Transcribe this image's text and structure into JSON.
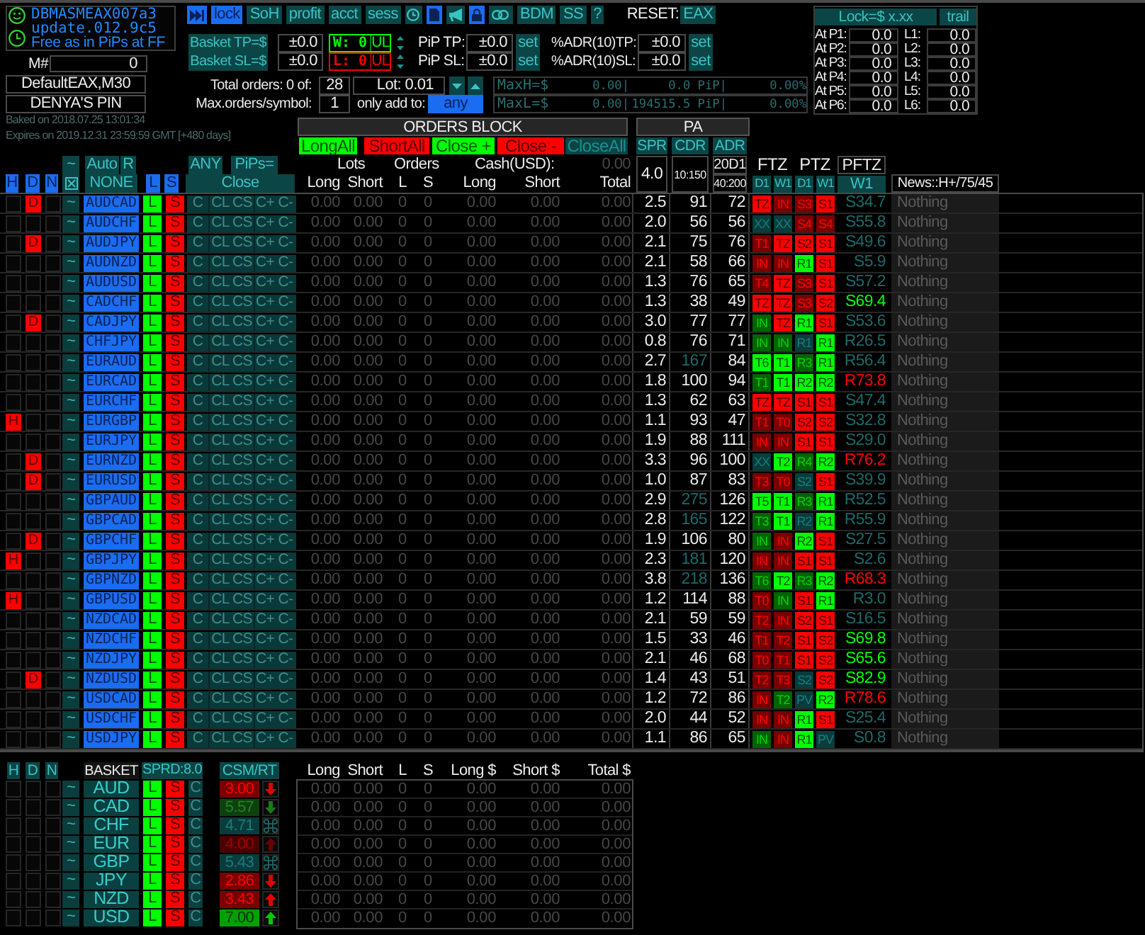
{
  "info": {
    "lines": [
      "DBMASMEAX007a3",
      "update.012.9c5",
      "Free as in PiPs at FF"
    ]
  },
  "magic": {
    "label": "M#",
    "value": "0"
  },
  "profile": [
    "DefaultEAX,M30",
    "DENYA'S PIN"
  ],
  "license": [
    "Baked on 2018.07.25 13:01:34",
    "Expires on 2019.12.31 23:59:59 GMT [+480 days]"
  ],
  "toolbar": [
    {
      "kind": "icon",
      "on": true
    },
    {
      "kind": "text",
      "label": "lock",
      "on": true
    },
    {
      "kind": "text",
      "label": "SoH",
      "on": false
    },
    {
      "kind": "text",
      "label": "profit",
      "on": false
    },
    {
      "kind": "text",
      "label": "acct",
      "on": false
    },
    {
      "kind": "text",
      "label": "sess",
      "on": false
    },
    {
      "kind": "icon",
      "on": false
    },
    {
      "kind": "icon",
      "on": true
    },
    {
      "kind": "icon",
      "on": false
    },
    {
      "kind": "icon",
      "on": true
    },
    {
      "kind": "icon",
      "on": false
    },
    {
      "kind": "text",
      "label": "BDM",
      "on": false
    },
    {
      "kind": "text",
      "label": "SS",
      "on": false
    },
    {
      "kind": "text",
      "label": "?",
      "on": false
    }
  ],
  "reset": {
    "label": "RESET:",
    "value": "EAX"
  },
  "targets": [
    {
      "button": "Basket TP=$",
      "value": "±0.0",
      "counter": "W: 0",
      "unit": "UL",
      "color": "#00ff00",
      "pip_label": "PiP TP:",
      "pip_value": "±0.0",
      "pip_set": "set",
      "adr_label": "%ADR(10)TP:",
      "adr_value": "±0.0",
      "adr_set": "set"
    },
    {
      "button": "Basket SL=$",
      "value": "±0.0",
      "counter": "L: 0",
      "unit": "UL",
      "color": "#ff0000",
      "pip_label": "PiP SL:",
      "pip_value": "±0.0",
      "pip_set": "set",
      "adr_label": "%ADR(10)SL:",
      "adr_value": "±0.0",
      "adr_set": "set"
    }
  ],
  "limits": {
    "total_label": "Total orders: 0 of:",
    "total_value": "28",
    "lot": "Lot: 0.01",
    "max_label": "Max.orders/symbol:",
    "max_value": "1",
    "add_label": "only add to:",
    "add_value": "any"
  },
  "max_rows": [
    {
      "label": "MaxH=$",
      "cells": [
        "0.00|",
        "0.0 PiP|",
        "0.00%"
      ]
    },
    {
      "label": "MaxL=$",
      "cells": [
        "0.00|",
        "194515.5 PiP|",
        "0.00%"
      ]
    }
  ],
  "lock": {
    "title": "Lock=$ x.xx",
    "trail": "trail",
    "rows": [
      {
        "at": "At P1:",
        "at_value": "0.0",
        "l": "L1:",
        "l_value": "0.0"
      },
      {
        "at": "At P2:",
        "at_value": "0.0",
        "l": "L2:",
        "l_value": "0.0"
      },
      {
        "at": "At P3:",
        "at_value": "0.0",
        "l": "L3:",
        "l_value": "0.0"
      },
      {
        "at": "At P4:",
        "at_value": "0.0",
        "l": "L4:",
        "l_value": "0.0"
      },
      {
        "at": "At P5:",
        "at_value": "0.0",
        "l": "L5:",
        "l_value": "0.0"
      },
      {
        "at": "At P6:",
        "at_value": "0.0",
        "l": "L6:",
        "l_value": "0.0"
      }
    ]
  },
  "orders_block": {
    "title": "ORDERS BLOCK",
    "buttons": [
      {
        "label": "LongAll",
        "color": "#00ff00"
      },
      {
        "label": "ShortAll",
        "color": "#ff0000"
      },
      {
        "label": "Close +",
        "color": "#00ff00"
      },
      {
        "label": "Close -",
        "color": "#ff0000"
      },
      {
        "label": "CloseAll",
        "color": "#0c4444"
      }
    ]
  },
  "pa": {
    "title": "PA",
    "buttons": [
      "SPR",
      "CDR",
      "ADR"
    ]
  },
  "filters_top": [
    {
      "label": "~",
      "on": false
    },
    {
      "label": "Auto",
      "on": false
    },
    {
      "label": "R",
      "on": false
    },
    {
      "label": "ANY",
      "on": false
    },
    {
      "label": "PiPs=",
      "on": false
    }
  ],
  "filters": [
    {
      "kind": "text",
      "label": "H",
      "on": true
    },
    {
      "kind": "text",
      "label": "D",
      "on": true
    },
    {
      "kind": "text",
      "label": "N",
      "on": true
    },
    {
      "kind": "icon",
      "on": false
    },
    {
      "kind": "text",
      "label": "NONE",
      "on": false
    },
    {
      "kind": "text",
      "label": "L",
      "on": true
    },
    {
      "kind": "text",
      "label": "S",
      "on": true
    },
    {
      "kind": "text",
      "label": "Close",
      "on": false
    }
  ],
  "totals_header": {
    "lots": "Lots",
    "orders": "Orders",
    "cash": "Cash(USD):",
    "cash_total": "0.00",
    "columns": [
      "Long",
      "Short",
      "L",
      "S",
      "Long",
      "Short",
      "Total"
    ]
  },
  "pa_header": {
    "spread": "4.0",
    "cdr": "10:150",
    "adr": [
      "20D1",
      "40:200"
    ],
    "zones": [
      "FTZ",
      "PTZ"
    ],
    "pftz": "PFTZ",
    "timeframes": [
      "D1",
      "W1",
      "D1",
      "W1"
    ],
    "pftz_timeframe": "W1",
    "news": "News::H+/75/45"
  },
  "pairs": [
    {
      "flag_d": "D",
      "tilde": "~",
      "pair": "AUDCAD",
      "long": "L",
      "short": "S",
      "close": [
        "C",
        "CL",
        "CS",
        "C+",
        "C-"
      ],
      "values": [
        "0.00",
        "0.00",
        "0",
        "0",
        "0.00",
        "0.00",
        "0.00"
      ],
      "spr": "2.5",
      "cdr": "91",
      "cdr_dim": false,
      "adr": "72",
      "zones": [
        {
          "label": "TZ",
          "color": "#ff0000"
        },
        {
          "label": "IN",
          "color": "#7a0000"
        },
        {
          "label": "S3",
          "color": "#7a0000"
        },
        {
          "label": "S1",
          "color": "#ff0000"
        }
      ],
      "pftz": {
        "text": "S34.7",
        "kind": "neutral"
      },
      "news": "Nothing"
    },
    {
      "tilde": "~",
      "pair": "AUDCHF",
      "long": "L",
      "short": "S",
      "close": [
        "C",
        "CL",
        "CS",
        "C+",
        "C-"
      ],
      "values": [
        "0.00",
        "0.00",
        "0",
        "0",
        "0.00",
        "0.00",
        "0.00"
      ],
      "spr": "2.0",
      "cdr": "56",
      "cdr_dim": false,
      "adr": "56",
      "zones": [
        {
          "label": "XX",
          "color": "#0a3c3c"
        },
        {
          "label": "XX",
          "color": "#0a3c3c"
        },
        {
          "label": "S4",
          "color": "#7a0000"
        },
        {
          "label": "S4",
          "color": "#7a0000"
        }
      ],
      "pftz": {
        "text": "S55.8",
        "kind": "neutral"
      },
      "news": "Nothing"
    },
    {
      "flag_d": "D",
      "tilde": "~",
      "pair": "AUDJPY",
      "long": "L",
      "short": "S",
      "close": [
        "C",
        "CL",
        "CS",
        "C+",
        "C-"
      ],
      "values": [
        "0.00",
        "0.00",
        "0",
        "0",
        "0.00",
        "0.00",
        "0.00"
      ],
      "spr": "2.1",
      "cdr": "75",
      "cdr_dim": false,
      "adr": "76",
      "zones": [
        {
          "label": "T1",
          "color": "#7a0000"
        },
        {
          "label": "TZ",
          "color": "#ff0000"
        },
        {
          "label": "S2",
          "color": "#ff0000"
        },
        {
          "label": "S1",
          "color": "#ff0000"
        }
      ],
      "pftz": {
        "text": "S49.6",
        "kind": "neutral"
      },
      "news": "Nothing"
    },
    {
      "tilde": "~",
      "pair": "AUDNZD",
      "long": "L",
      "short": "S",
      "close": [
        "C",
        "CL",
        "CS",
        "C+",
        "C-"
      ],
      "values": [
        "0.00",
        "0.00",
        "0",
        "0",
        "0.00",
        "0.00",
        "0.00"
      ],
      "spr": "2.1",
      "cdr": "58",
      "cdr_dim": false,
      "adr": "66",
      "zones": [
        {
          "label": "IN",
          "color": "#7a0000"
        },
        {
          "label": "IN",
          "color": "#7a0000"
        },
        {
          "label": "R1",
          "color": "#00ff00"
        },
        {
          "label": "S1",
          "color": "#ff0000"
        }
      ],
      "pftz": {
        "text": "S5.9",
        "kind": "neutral"
      },
      "news": "Nothing"
    },
    {
      "tilde": "~",
      "pair": "AUDUSD",
      "long": "L",
      "short": "S",
      "close": [
        "C",
        "CL",
        "CS",
        "C+",
        "C-"
      ],
      "values": [
        "0.00",
        "0.00",
        "0",
        "0",
        "0.00",
        "0.00",
        "0.00"
      ],
      "spr": "1.3",
      "cdr": "76",
      "cdr_dim": false,
      "adr": "65",
      "zones": [
        {
          "label": "T4",
          "color": "#7a0000"
        },
        {
          "label": "TZ",
          "color": "#ff0000"
        },
        {
          "label": "S3",
          "color": "#7a0000"
        },
        {
          "label": "S1",
          "color": "#ff0000"
        }
      ],
      "pftz": {
        "text": "S57.2",
        "kind": "neutral"
      },
      "news": "Nothing"
    },
    {
      "tilde": "~",
      "pair": "CADCHF",
      "long": "L",
      "short": "S",
      "close": [
        "C",
        "CL",
        "CS",
        "C+",
        "C-"
      ],
      "values": [
        "0.00",
        "0.00",
        "0",
        "0",
        "0.00",
        "0.00",
        "0.00"
      ],
      "spr": "1.3",
      "cdr": "38",
      "cdr_dim": false,
      "adr": "49",
      "zones": [
        {
          "label": "TZ",
          "color": "#ff0000"
        },
        {
          "label": "TZ",
          "color": "#ff0000"
        },
        {
          "label": "S3",
          "color": "#7a0000"
        },
        {
          "label": "S2",
          "color": "#ff0000"
        }
      ],
      "pftz": {
        "text": "S69.4",
        "kind": "support"
      },
      "news": "Nothing"
    },
    {
      "flag_d": "D",
      "tilde": "~",
      "pair": "CADJPY",
      "long": "L",
      "short": "S",
      "close": [
        "C",
        "CL",
        "CS",
        "C+",
        "C-"
      ],
      "values": [
        "0.00",
        "0.00",
        "0",
        "0",
        "0.00",
        "0.00",
        "0.00"
      ],
      "spr": "3.0",
      "cdr": "77",
      "cdr_dim": false,
      "adr": "77",
      "zones": [
        {
          "label": "IN",
          "color": "#006400"
        },
        {
          "label": "TZ",
          "color": "#ff0000"
        },
        {
          "label": "R1",
          "color": "#00ff00"
        },
        {
          "label": "S1",
          "color": "#ff0000"
        }
      ],
      "pftz": {
        "text": "S53.6",
        "kind": "neutral"
      },
      "news": "Nothing"
    },
    {
      "tilde": "~",
      "pair": "CHFJPY",
      "long": "L",
      "short": "S",
      "close": [
        "C",
        "CL",
        "CS",
        "C+",
        "C-"
      ],
      "values": [
        "0.00",
        "0.00",
        "0",
        "0",
        "0.00",
        "0.00",
        "0.00"
      ],
      "spr": "0.8",
      "cdr": "76",
      "cdr_dim": false,
      "adr": "71",
      "zones": [
        {
          "label": "IN",
          "color": "#006400"
        },
        {
          "label": "IN",
          "color": "#006400"
        },
        {
          "label": "R1",
          "color": "#0a3c3c"
        },
        {
          "label": "R1",
          "color": "#00ff00"
        }
      ],
      "pftz": {
        "text": "R26.5",
        "kind": "neutral"
      },
      "news": "Nothing"
    },
    {
      "tilde": "~",
      "pair": "EURAUD",
      "long": "L",
      "short": "S",
      "close": [
        "C",
        "CL",
        "CS",
        "C+",
        "C-"
      ],
      "values": [
        "0.00",
        "0.00",
        "0",
        "0",
        "0.00",
        "0.00",
        "0.00"
      ],
      "spr": "2.7",
      "cdr": "167",
      "cdr_dim": true,
      "adr": "84",
      "zones": [
        {
          "label": "T6",
          "color": "#00ff00"
        },
        {
          "label": "T1",
          "color": "#00ff00"
        },
        {
          "label": "R3",
          "color": "#006400"
        },
        {
          "label": "R1",
          "color": "#00ff00"
        }
      ],
      "pftz": {
        "text": "R56.4",
        "kind": "neutral"
      },
      "news": "Nothing"
    },
    {
      "tilde": "~",
      "pair": "EURCAD",
      "long": "L",
      "short": "S",
      "close": [
        "C",
        "CL",
        "CS",
        "C+",
        "C-"
      ],
      "values": [
        "0.00",
        "0.00",
        "0",
        "0",
        "0.00",
        "0.00",
        "0.00"
      ],
      "spr": "1.8",
      "cdr": "100",
      "cdr_dim": false,
      "adr": "94",
      "zones": [
        {
          "label": "T1",
          "color": "#006400"
        },
        {
          "label": "T1",
          "color": "#00ff00"
        },
        {
          "label": "R2",
          "color": "#00ff00"
        },
        {
          "label": "R2",
          "color": "#00ff00"
        }
      ],
      "pftz": {
        "text": "R73.8",
        "kind": "resistance"
      },
      "news": "Nothing"
    },
    {
      "tilde": "~",
      "pair": "EURCHF",
      "long": "L",
      "short": "S",
      "close": [
        "C",
        "CL",
        "CS",
        "C+",
        "C-"
      ],
      "values": [
        "0.00",
        "0.00",
        "0",
        "0",
        "0.00",
        "0.00",
        "0.00"
      ],
      "spr": "1.3",
      "cdr": "62",
      "cdr_dim": false,
      "adr": "63",
      "zones": [
        {
          "label": "TZ",
          "color": "#ff0000"
        },
        {
          "label": "TZ",
          "color": "#ff0000"
        },
        {
          "label": "S1",
          "color": "#ff0000"
        },
        {
          "label": "S1",
          "color": "#ff0000"
        }
      ],
      "pftz": {
        "text": "S47.4",
        "kind": "neutral"
      },
      "news": "Nothing"
    },
    {
      "flag_h": "H",
      "tilde": "~",
      "pair": "EURGBP",
      "long": "L",
      "short": "S",
      "close": [
        "C",
        "CL",
        "CS",
        "C+",
        "C-"
      ],
      "values": [
        "0.00",
        "0.00",
        "0",
        "0",
        "0.00",
        "0.00",
        "0.00"
      ],
      "spr": "1.1",
      "cdr": "93",
      "cdr_dim": false,
      "adr": "47",
      "zones": [
        {
          "label": "T1",
          "color": "#7a0000"
        },
        {
          "label": "T0",
          "color": "#7a0000"
        },
        {
          "label": "S2",
          "color": "#ff0000"
        },
        {
          "label": "S2",
          "color": "#ff0000"
        }
      ],
      "pftz": {
        "text": "S32.8",
        "kind": "neutral"
      },
      "news": "Nothing"
    },
    {
      "tilde": "~",
      "pair": "EURJPY",
      "long": "L",
      "short": "S",
      "close": [
        "C",
        "CL",
        "CS",
        "C+",
        "C-"
      ],
      "values": [
        "0.00",
        "0.00",
        "0",
        "0",
        "0.00",
        "0.00",
        "0.00"
      ],
      "spr": "1.9",
      "cdr": "88",
      "cdr_dim": false,
      "adr": "111",
      "zones": [
        {
          "label": "IN",
          "color": "#7a0000"
        },
        {
          "label": "IN",
          "color": "#7a0000"
        },
        {
          "label": "S1",
          "color": "#ff0000"
        },
        {
          "label": "S1",
          "color": "#ff0000"
        }
      ],
      "pftz": {
        "text": "S29.0",
        "kind": "neutral"
      },
      "news": "Nothing"
    },
    {
      "flag_d": "D",
      "tilde": "~",
      "pair": "EURNZD",
      "long": "L",
      "short": "S",
      "close": [
        "C",
        "CL",
        "CS",
        "C+",
        "C-"
      ],
      "values": [
        "0.00",
        "0.00",
        "0",
        "0",
        "0.00",
        "0.00",
        "0.00"
      ],
      "spr": "3.3",
      "cdr": "96",
      "cdr_dim": false,
      "adr": "100",
      "zones": [
        {
          "label": "XX",
          "color": "#0a3c3c"
        },
        {
          "label": "T2",
          "color": "#00ff00"
        },
        {
          "label": "R4",
          "color": "#006400"
        },
        {
          "label": "R2",
          "color": "#00ff00"
        }
      ],
      "pftz": {
        "text": "R76.2",
        "kind": "resistance"
      },
      "news": "Nothing"
    },
    {
      "flag_d": "D",
      "tilde": "~",
      "pair": "EURUSD",
      "long": "L",
      "short": "S",
      "close": [
        "C",
        "CL",
        "CS",
        "C+",
        "C-"
      ],
      "values": [
        "0.00",
        "0.00",
        "0",
        "0",
        "0.00",
        "0.00",
        "0.00"
      ],
      "spr": "1.0",
      "cdr": "87",
      "cdr_dim": false,
      "adr": "83",
      "zones": [
        {
          "label": "T3",
          "color": "#7a0000"
        },
        {
          "label": "T0",
          "color": "#7a0000"
        },
        {
          "label": "S2",
          "color": "#0a3c3c"
        },
        {
          "label": "S1",
          "color": "#ff0000"
        }
      ],
      "pftz": {
        "text": "S39.9",
        "kind": "neutral"
      },
      "news": "Nothing"
    },
    {
      "tilde": "~",
      "pair": "GBPAUD",
      "long": "L",
      "short": "S",
      "close": [
        "C",
        "CL",
        "CS",
        "C+",
        "C-"
      ],
      "values": [
        "0.00",
        "0.00",
        "0",
        "0",
        "0.00",
        "0.00",
        "0.00"
      ],
      "spr": "2.9",
      "cdr": "275",
      "cdr_dim": true,
      "adr": "126",
      "zones": [
        {
          "label": "T5",
          "color": "#00ff00"
        },
        {
          "label": "T1",
          "color": "#00ff00"
        },
        {
          "label": "R3",
          "color": "#006400"
        },
        {
          "label": "R1",
          "color": "#00ff00"
        }
      ],
      "pftz": {
        "text": "R52.5",
        "kind": "neutral"
      },
      "news": "Nothing"
    },
    {
      "tilde": "~",
      "pair": "GBPCAD",
      "long": "L",
      "short": "S",
      "close": [
        "C",
        "CL",
        "CS",
        "C+",
        "C-"
      ],
      "values": [
        "0.00",
        "0.00",
        "0",
        "0",
        "0.00",
        "0.00",
        "0.00"
      ],
      "spr": "2.8",
      "cdr": "165",
      "cdr_dim": true,
      "adr": "122",
      "zones": [
        {
          "label": "T3",
          "color": "#006400"
        },
        {
          "label": "T1",
          "color": "#00ff00"
        },
        {
          "label": "R2",
          "color": "#0a3c3c"
        },
        {
          "label": "R1",
          "color": "#00ff00"
        }
      ],
      "pftz": {
        "text": "R55.9",
        "kind": "neutral"
      },
      "news": "Nothing"
    },
    {
      "flag_d": "D",
      "tilde": "~",
      "pair": "GBPCHF",
      "long": "L",
      "short": "S",
      "close": [
        "C",
        "CL",
        "CS",
        "C+",
        "C-"
      ],
      "values": [
        "0.00",
        "0.00",
        "0",
        "0",
        "0.00",
        "0.00",
        "0.00"
      ],
      "spr": "1.9",
      "cdr": "106",
      "cdr_dim": false,
      "adr": "80",
      "zones": [
        {
          "label": "IN",
          "color": "#006400"
        },
        {
          "label": "IN",
          "color": "#7a0000"
        },
        {
          "label": "R2",
          "color": "#00ff00"
        },
        {
          "label": "S1",
          "color": "#ff0000"
        }
      ],
      "pftz": {
        "text": "S27.5",
        "kind": "neutral"
      },
      "news": "Nothing"
    },
    {
      "flag_h": "H",
      "tilde": "~",
      "pair": "GBPJPY",
      "long": "L",
      "short": "S",
      "close": [
        "C",
        "CL",
        "CS",
        "C+",
        "C-"
      ],
      "values": [
        "0.00",
        "0.00",
        "0",
        "0",
        "0.00",
        "0.00",
        "0.00"
      ],
      "spr": "2.3",
      "cdr": "181",
      "cdr_dim": true,
      "adr": "120",
      "zones": [
        {
          "label": "IN",
          "color": "#7a0000"
        },
        {
          "label": "IN",
          "color": "#7a0000"
        },
        {
          "label": "S1",
          "color": "#ff0000"
        },
        {
          "label": "S1",
          "color": "#ff0000"
        }
      ],
      "pftz": {
        "text": "S2.6",
        "kind": "neutral"
      },
      "news": "Nothing"
    },
    {
      "tilde": "~",
      "pair": "GBPNZD",
      "long": "L",
      "short": "S",
      "close": [
        "C",
        "CL",
        "CS",
        "C+",
        "C-"
      ],
      "values": [
        "0.00",
        "0.00",
        "0",
        "0",
        "0.00",
        "0.00",
        "0.00"
      ],
      "spr": "3.8",
      "cdr": "218",
      "cdr_dim": true,
      "adr": "136",
      "zones": [
        {
          "label": "T6",
          "color": "#006400"
        },
        {
          "label": "T2",
          "color": "#00ff00"
        },
        {
          "label": "R3",
          "color": "#006400"
        },
        {
          "label": "R2",
          "color": "#00ff00"
        }
      ],
      "pftz": {
        "text": "R68.3",
        "kind": "resistance"
      },
      "news": "Nothing"
    },
    {
      "flag_h": "H",
      "tilde": "~",
      "pair": "GBPUSD",
      "long": "L",
      "short": "S",
      "close": [
        "C",
        "CL",
        "CS",
        "C+",
        "C-"
      ],
      "values": [
        "0.00",
        "0.00",
        "0",
        "0",
        "0.00",
        "0.00",
        "0.00"
      ],
      "spr": "1.2",
      "cdr": "114",
      "cdr_dim": false,
      "adr": "88",
      "zones": [
        {
          "label": "T0",
          "color": "#7a0000"
        },
        {
          "label": "IN",
          "color": "#006400"
        },
        {
          "label": "S1",
          "color": "#ff0000"
        },
        {
          "label": "R1",
          "color": "#00ff00"
        }
      ],
      "pftz": {
        "text": "R3.0",
        "kind": "neutral"
      },
      "news": "Nothing"
    },
    {
      "tilde": "~",
      "pair": "NZDCAD",
      "long": "L",
      "short": "S",
      "close": [
        "C",
        "CL",
        "CS",
        "C+",
        "C-"
      ],
      "values": [
        "0.00",
        "0.00",
        "0",
        "0",
        "0.00",
        "0.00",
        "0.00"
      ],
      "spr": "2.1",
      "cdr": "59",
      "cdr_dim": false,
      "adr": "59",
      "zones": [
        {
          "label": "T2",
          "color": "#7a0000"
        },
        {
          "label": "IN",
          "color": "#7a0000"
        },
        {
          "label": "S2",
          "color": "#ff0000"
        },
        {
          "label": "S1",
          "color": "#ff0000"
        }
      ],
      "pftz": {
        "text": "S16.5",
        "kind": "neutral"
      },
      "news": "Nothing"
    },
    {
      "tilde": "~",
      "pair": "NZDCHF",
      "long": "L",
      "short": "S",
      "close": [
        "C",
        "CL",
        "CS",
        "C+",
        "C-"
      ],
      "values": [
        "0.00",
        "0.00",
        "0",
        "0",
        "0.00",
        "0.00",
        "0.00"
      ],
      "spr": "1.5",
      "cdr": "33",
      "cdr_dim": false,
      "adr": "46",
      "zones": [
        {
          "label": "T1",
          "color": "#7a0000"
        },
        {
          "label": "T2",
          "color": "#7a0000"
        },
        {
          "label": "S1",
          "color": "#ff0000"
        },
        {
          "label": "S2",
          "color": "#ff0000"
        }
      ],
      "pftz": {
        "text": "S69.8",
        "kind": "support"
      },
      "news": "Nothing"
    },
    {
      "tilde": "~",
      "pair": "NZDJPY",
      "long": "L",
      "short": "S",
      "close": [
        "C",
        "CL",
        "CS",
        "C+",
        "C-"
      ],
      "values": [
        "0.00",
        "0.00",
        "0",
        "0",
        "0.00",
        "0.00",
        "0.00"
      ],
      "spr": "2.1",
      "cdr": "46",
      "cdr_dim": false,
      "adr": "68",
      "zones": [
        {
          "label": "T0",
          "color": "#7a0000"
        },
        {
          "label": "T1",
          "color": "#7a0000"
        },
        {
          "label": "S1",
          "color": "#ff0000"
        },
        {
          "label": "S2",
          "color": "#ff0000"
        }
      ],
      "pftz": {
        "text": "S65.6",
        "kind": "support"
      },
      "news": "Nothing"
    },
    {
      "flag_d": "D",
      "tilde": "~",
      "pair": "NZDUSD",
      "long": "L",
      "short": "S",
      "close": [
        "C",
        "CL",
        "CS",
        "C+",
        "C-"
      ],
      "values": [
        "0.00",
        "0.00",
        "0",
        "0",
        "0.00",
        "0.00",
        "0.00"
      ],
      "spr": "1.4",
      "cdr": "43",
      "cdr_dim": false,
      "adr": "51",
      "zones": [
        {
          "label": "T2",
          "color": "#7a0000"
        },
        {
          "label": "T3",
          "color": "#7a0000"
        },
        {
          "label": "S2",
          "color": "#0a3c3c"
        },
        {
          "label": "S2",
          "color": "#ff0000"
        }
      ],
      "pftz": {
        "text": "S82.9",
        "kind": "support"
      },
      "news": "Nothing"
    },
    {
      "tilde": "~",
      "pair": "USDCAD",
      "long": "L",
      "short": "S",
      "close": [
        "C",
        "CL",
        "CS",
        "C+",
        "C-"
      ],
      "values": [
        "0.00",
        "0.00",
        "0",
        "0",
        "0.00",
        "0.00",
        "0.00"
      ],
      "spr": "1.2",
      "cdr": "72",
      "cdr_dim": false,
      "adr": "86",
      "zones": [
        {
          "label": "IN",
          "color": "#7a0000"
        },
        {
          "label": "T2",
          "color": "#006400"
        },
        {
          "label": "PV",
          "color": "#0a3c3c"
        },
        {
          "label": "R2",
          "color": "#00ff00"
        }
      ],
      "pftz": {
        "text": "R78.6",
        "kind": "resistance"
      },
      "news": "Nothing"
    },
    {
      "tilde": "~",
      "pair": "USDCHF",
      "long": "L",
      "short": "S",
      "close": [
        "C",
        "CL",
        "CS",
        "C+",
        "C-"
      ],
      "values": [
        "0.00",
        "0.00",
        "0",
        "0",
        "0.00",
        "0.00",
        "0.00"
      ],
      "spr": "2.0",
      "cdr": "44",
      "cdr_dim": false,
      "adr": "52",
      "zones": [
        {
          "label": "IN",
          "color": "#7a0000"
        },
        {
          "label": "IN",
          "color": "#7a0000"
        },
        {
          "label": "R1",
          "color": "#00ff00"
        },
        {
          "label": "S1",
          "color": "#ff0000"
        }
      ],
      "pftz": {
        "text": "S25.4",
        "kind": "neutral"
      },
      "news": "Nothing"
    },
    {
      "tilde": "~",
      "pair": "USDJPY",
      "long": "L",
      "short": "S",
      "close": [
        "C",
        "CL",
        "CS",
        "C+",
        "C-"
      ],
      "values": [
        "0.00",
        "0.00",
        "0",
        "0",
        "0.00",
        "0.00",
        "0.00"
      ],
      "spr": "1.1",
      "cdr": "86",
      "cdr_dim": false,
      "adr": "65",
      "zones": [
        {
          "label": "IN",
          "color": "#006400"
        },
        {
          "label": "IN",
          "color": "#7a0000"
        },
        {
          "label": "R1",
          "color": "#00ff00"
        },
        {
          "label": "PV",
          "color": "#0a3c3c"
        }
      ],
      "pftz": {
        "text": "S0.8",
        "kind": "neutral"
      },
      "news": "Nothing"
    }
  ],
  "basket": {
    "flags": [
      "H",
      "D",
      "N"
    ],
    "title": "BASKET",
    "spread": "SPRD:8.0",
    "csm": "CSM/RT",
    "columns": [
      "Long",
      "Short",
      "L",
      "S",
      "Long $",
      "Short $",
      "Total $"
    ],
    "rows": [
      {
        "tilde": "~",
        "currency": "AUD",
        "long": "L",
        "short": "S",
        "close": "C",
        "strength": {
          "text": "3.00",
          "color": "#7a0000"
        },
        "trend": {
          "kind": "down",
          "color": "#e00000"
        },
        "values": [
          "0.00",
          "0.00",
          "0",
          "0",
          "0.00",
          "0.00",
          "0.00"
        ]
      },
      {
        "tilde": "~",
        "currency": "CAD",
        "long": "L",
        "short": "S",
        "close": "C",
        "strength": {
          "text": "5.57",
          "color": "#0f400f"
        },
        "trend": {
          "kind": "down",
          "color": "#1a7a1a"
        },
        "values": [
          "0.00",
          "0.00",
          "0",
          "0",
          "0.00",
          "0.00",
          "0.00"
        ]
      },
      {
        "tilde": "~",
        "currency": "CHF",
        "long": "L",
        "short": "S",
        "close": "C",
        "strength": {
          "text": "4.71",
          "color": "#0a3c3c"
        },
        "trend": {
          "kind": "flat",
          "color": "#1a6060"
        },
        "values": [
          "0.00",
          "0.00",
          "0",
          "0",
          "0.00",
          "0.00",
          "0.00"
        ]
      },
      {
        "tilde": "~",
        "currency": "EUR",
        "long": "L",
        "short": "S",
        "close": "C",
        "strength": {
          "text": "4.00",
          "color": "#4a0000"
        },
        "trend": {
          "kind": "up",
          "color": "#6a0000"
        },
        "values": [
          "0.00",
          "0.00",
          "0",
          "0",
          "0.00",
          "0.00",
          "0.00"
        ]
      },
      {
        "tilde": "~",
        "currency": "GBP",
        "long": "L",
        "short": "S",
        "close": "C",
        "strength": {
          "text": "5.43",
          "color": "#0a3c3c"
        },
        "trend": {
          "kind": "flat",
          "color": "#1a6060"
        },
        "values": [
          "0.00",
          "0.00",
          "0",
          "0",
          "0.00",
          "0.00",
          "0.00"
        ]
      },
      {
        "tilde": "~",
        "currency": "JPY",
        "long": "L",
        "short": "S",
        "close": "C",
        "strength": {
          "text": "2.86",
          "color": "#7a0000"
        },
        "trend": {
          "kind": "down",
          "color": "#e00000"
        },
        "values": [
          "0.00",
          "0.00",
          "0",
          "0",
          "0.00",
          "0.00",
          "0.00"
        ]
      },
      {
        "tilde": "~",
        "currency": "NZD",
        "long": "L",
        "short": "S",
        "close": "C",
        "strength": {
          "text": "3.43",
          "color": "#7a0000"
        },
        "trend": {
          "kind": "up",
          "color": "#e00000"
        },
        "values": [
          "0.00",
          "0.00",
          "0",
          "0",
          "0.00",
          "0.00",
          "0.00"
        ]
      },
      {
        "tilde": "~",
        "currency": "USD",
        "long": "L",
        "short": "S",
        "close": "C",
        "strength": {
          "text": "7.00",
          "color": "#00a000"
        },
        "trend": {
          "kind": "up",
          "color": "#00c800"
        },
        "values": [
          "0.00",
          "0.00",
          "0",
          "0",
          "0.00",
          "0.00",
          "0.00"
        ]
      }
    ]
  }
}
